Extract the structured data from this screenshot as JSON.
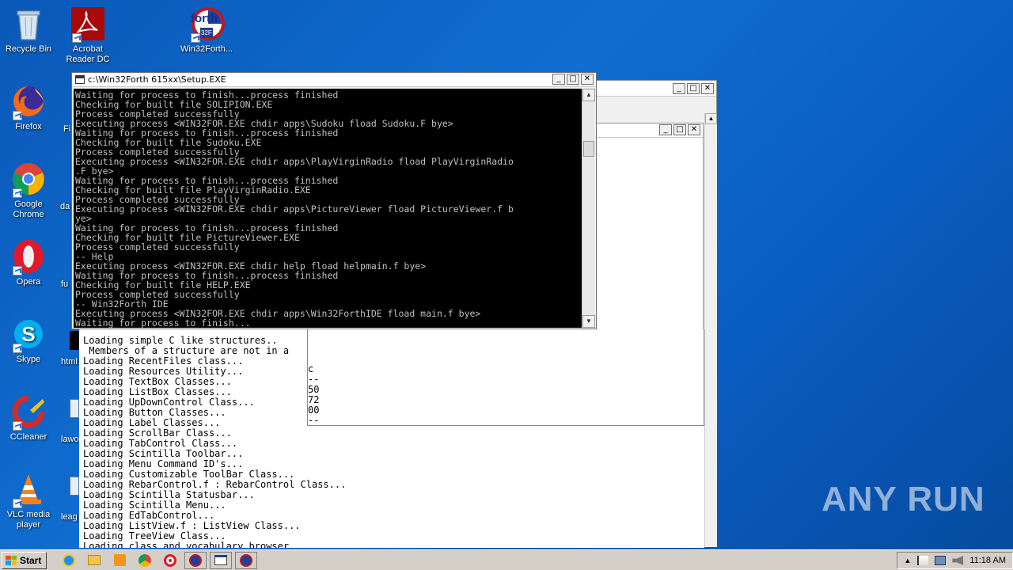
{
  "desktop": {
    "icons": [
      {
        "label": "Recycle Bin"
      },
      {
        "label": "Acrobat Reader DC"
      },
      {
        "label": "Win32Forth..."
      },
      {
        "label": "Firefox"
      },
      {
        "label": "Google Chrome"
      },
      {
        "label": "Opera"
      },
      {
        "label": "Skype"
      },
      {
        "label": "CCleaner"
      },
      {
        "label": "VLC media player"
      }
    ],
    "partial_labels": [
      "Fi",
      "da",
      "fu",
      "html",
      "lawo",
      "leag"
    ],
    "forth_icon_text": "forth",
    "forth_icon_sub": "32F"
  },
  "console": {
    "title": "c:\\Win32Forth 615xx\\Setup.EXE",
    "lines": [
      "Waiting for process to finish...process finished",
      "Checking for built file SOLIPION.EXE",
      "Process completed successfully",
      "Executing process <WIN32FOR.EXE chdir apps\\Sudoku fload Sudoku.F bye>",
      "Waiting for process to finish...process finished",
      "Checking for built file Sudoku.EXE",
      "Process completed successfully",
      "Executing process <WIN32FOR.EXE chdir apps\\PlayVirginRadio fload PlayVirginRadio",
      ".F bye>",
      "Waiting for process to finish...process finished",
      "Checking for built file PlayVirginRadio.EXE",
      "Process completed successfully",
      "Executing process <WIN32FOR.EXE chdir apps\\PictureViewer fload PictureViewer.f b",
      "ye>",
      "Waiting for process to finish...process finished",
      "Checking for built file PictureViewer.EXE",
      "Process completed successfully",
      "-- Help",
      "Executing process <WIN32FOR.EXE chdir help fload helpmain.f bye>",
      "Waiting for process to finish...process finished",
      "Checking for built file HELP.EXE",
      "Process completed successfully",
      "-- Win32Forth IDE",
      "Executing process <WIN32FOR.EXE chdir apps\\Win32ForthIDE fload main.f bye>",
      "Waiting for process to finish..."
    ]
  },
  "ide_log": {
    "lines": [
      "Loading simple C like structures..",
      " Members of a structure are not in a",
      "Loading RecentFiles class...",
      "Loading Resources Utility...",
      "Loading TextBox Classes...",
      "Loading ListBox Classes...",
      "Loading UpDownControl Class...",
      "Loading Button Classes...",
      "Loading Label Classes...",
      "Loading ScrollBar Class...",
      "Loading TabControl Class...",
      "Loading Scintilla Toolbar...",
      "Loading Menu Command ID's...",
      "Loading Customizable ToolBar Class...",
      "Loading RebarControl.f : RebarControl Class...",
      "Loading Scintilla Statusbar...",
      "Loading Scintilla Menu...",
      "Loading EdTabControl...",
      "Loading ListView.f : ListView Class...",
      "Loading TreeView Class...",
      "Loading class and vocabulary browser..."
    ],
    "popup_fragments": [
      "c",
      "--",
      "50",
      "72",
      "00",
      "--"
    ]
  },
  "window_buttons": {
    "minimize": "_",
    "maximize": "□",
    "close": "✕"
  },
  "watermark": "ANY RUN",
  "taskbar": {
    "start_label": "Start",
    "clock": "11:18 AM",
    "apps": [
      "ie-icon",
      "explorer-icon",
      "media-icon",
      "chrome-icon",
      "opera-icon",
      "forth-icon",
      "window-icon",
      "forth-icon-2"
    ]
  }
}
